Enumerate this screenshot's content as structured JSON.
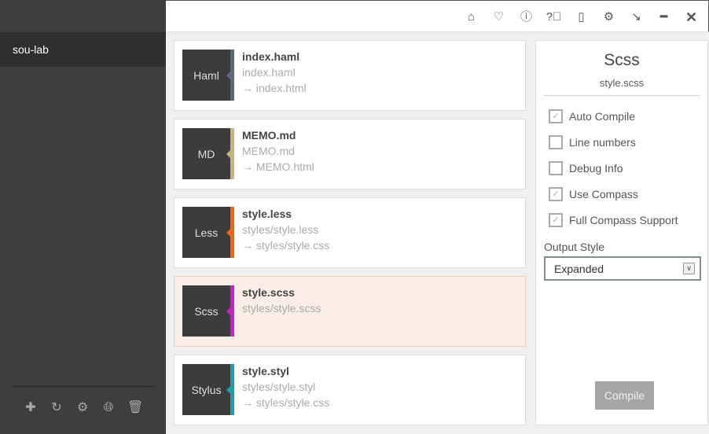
{
  "sidebar": {
    "project": "sou-lab",
    "icons": [
      "plus-icon",
      "refresh-icon",
      "gear-icon",
      "globe-icon",
      "trash-icon"
    ]
  },
  "topbar": {
    "icons": [
      "home-icon",
      "heart-icon",
      "info-icon",
      "help-icon",
      "clipboard-icon",
      "gear-icon",
      "arrow-down-right-icon",
      "minimize-icon",
      "close-icon"
    ]
  },
  "files": [
    {
      "badge": "Haml",
      "color": "#5b6b7f",
      "name": "index.haml",
      "path": "index.haml",
      "output": "→ index.html"
    },
    {
      "badge": "MD",
      "color": "#c9b47b",
      "name": "MEMO.md",
      "path": "MEMO.md",
      "output": "→ MEMO.html"
    },
    {
      "badge": "Less",
      "color": "#f1690d",
      "name": "style.less",
      "path": "styles/style.less",
      "output": "→ styles/style.css"
    },
    {
      "badge": "Scss",
      "color": "#c425c9",
      "name": "style.scss",
      "path": "styles/style.scss",
      "output": "",
      "selected": true
    },
    {
      "badge": "Stylus",
      "color": "#179fb2",
      "name": "style.styl",
      "path": "styles/style.styl",
      "output": "→ styles/style.css"
    }
  ],
  "panel": {
    "title": "Scss",
    "file": "style.scss",
    "options": [
      {
        "label": "Auto Compile",
        "checked": true
      },
      {
        "label": "Line numbers",
        "checked": false
      },
      {
        "label": "Debug Info",
        "checked": false
      },
      {
        "label": "Use Compass",
        "checked": true
      },
      {
        "label": "Full Compass Support",
        "checked": true
      }
    ],
    "output_style_label": "Output Style",
    "output_style": "Expanded",
    "compile": "Compile"
  }
}
